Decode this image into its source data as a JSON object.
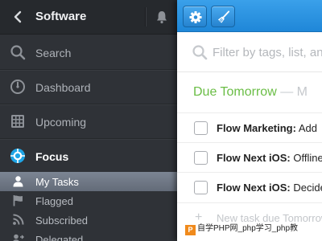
{
  "sidebar": {
    "title": "Software",
    "nav": [
      {
        "label": "Search",
        "icon": "search-icon"
      },
      {
        "label": "Dashboard",
        "icon": "dashboard-icon"
      },
      {
        "label": "Upcoming",
        "icon": "calendar-grid-icon"
      },
      {
        "label": "Focus",
        "icon": "focus-icon"
      }
    ],
    "sub": [
      {
        "label": "My Tasks",
        "icon": "person-icon",
        "active": true
      },
      {
        "label": "Flagged",
        "icon": "flag-icon"
      },
      {
        "label": "Subscribed",
        "icon": "rss-icon"
      },
      {
        "label": "Delegated",
        "icon": "delegate-icon"
      }
    ]
  },
  "toolbar": {
    "settings_icon": "gear-icon",
    "clean_icon": "broom-icon"
  },
  "search": {
    "placeholder": "Filter by tags, list, and more"
  },
  "section": {
    "title": "Due Tomorrow",
    "separator": " — M"
  },
  "tasks": [
    {
      "project": "Flow Marketing:",
      "text": " Add"
    },
    {
      "project": "Flow Next iOS:",
      "text": " Offline"
    },
    {
      "project": "Flow Next iOS:",
      "text": " Decide"
    }
  ],
  "new_task": {
    "label": "New task due Tomorrow"
  },
  "watermark": {
    "logo": "P",
    "text": "自学PHP网_php学习_php教"
  },
  "colors": {
    "accent_blue": "#2a90dd",
    "due_green": "#6abd45",
    "focus_blue": "#1fa5e6"
  }
}
